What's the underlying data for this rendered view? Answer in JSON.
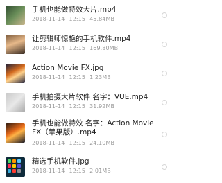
{
  "files": [
    {
      "name": "手机也能做特效大片.mp4",
      "date": "2018-11-14",
      "time": "12:15",
      "size": "45.84MB"
    },
    {
      "name": "让剪辑师惊艳的手机软件.mp4",
      "date": "2018-11-14",
      "time": "12:15",
      "size": "169.80MB"
    },
    {
      "name": "Action Movie FX.jpg",
      "date": "2018-11-14",
      "time": "12:15",
      "size": "1.23MB"
    },
    {
      "name": "手机拍摄大片软件 名字：VUE.mp4",
      "date": "2018-11-14",
      "time": "12:15",
      "size": "31.92MB"
    },
    {
      "name": "手机也能做特效 名字：Action Movie FX（苹果版）.mp4",
      "date": "2018-11-14",
      "time": "12:15",
      "size": "24.10MB"
    },
    {
      "name": "精选手机软件.jpg",
      "date": "2018-11-14",
      "time": "12:15",
      "size": "2.01MB"
    }
  ]
}
